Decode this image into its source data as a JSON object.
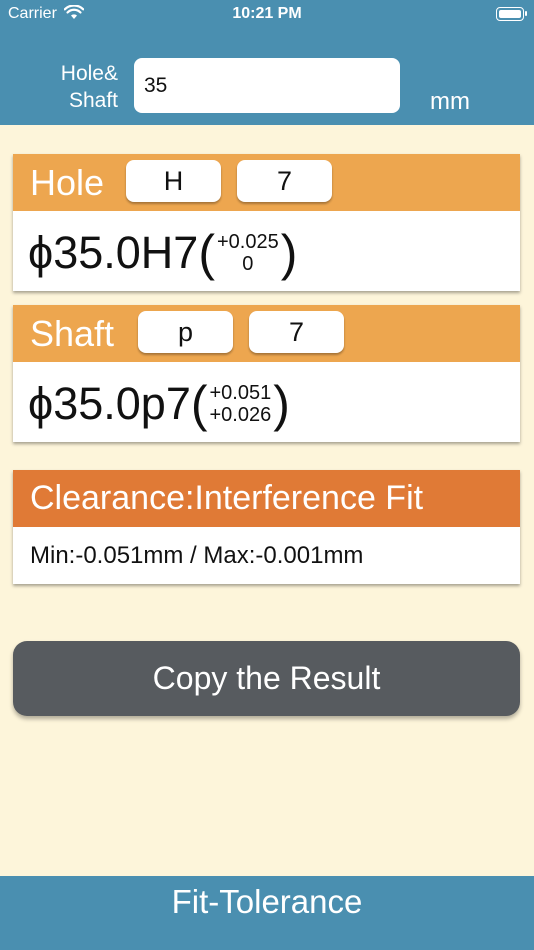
{
  "status": {
    "carrier": "Carrier",
    "time": "10:21 PM"
  },
  "size": {
    "label_line1": "Hole&",
    "label_line2": "Shaft",
    "value": "35",
    "unit": "mm"
  },
  "hole": {
    "title": "Hole",
    "letter": "H",
    "grade": "7",
    "dimension": "ϕ35.0H7",
    "upper": "+0.025",
    "lower": "0"
  },
  "shaft": {
    "title": "Shaft",
    "letter": "p",
    "grade": "7",
    "dimension": "ϕ35.0p7",
    "upper": "+0.051",
    "lower": "+0.026"
  },
  "fit": {
    "title": "Clearance:Interference Fit",
    "range": "Min:-0.051mm / Max:-0.001mm"
  },
  "copy_label": "Copy the Result",
  "footer_title": "Fit-Tolerance",
  "colors": {
    "header": "#4a8fb0",
    "background": "#fdf5da",
    "card_header": "#eda64f",
    "fit_header": "#e07a36",
    "button": "#575b5f"
  }
}
